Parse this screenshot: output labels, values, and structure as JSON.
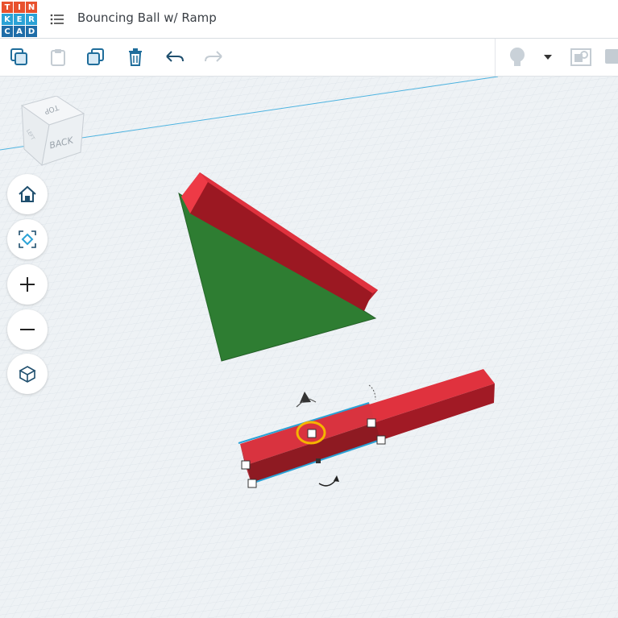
{
  "app": {
    "logo_letters": [
      "T",
      "I",
      "N",
      "K",
      "E",
      "R",
      "C",
      "A",
      "D"
    ],
    "logo_colors": [
      "#e8512d",
      "#e8512d",
      "#e8512d",
      "#2aa2d6",
      "#2aa2d6",
      "#2aa2d6",
      "#1e6da8",
      "#1e6da8",
      "#1e6da8"
    ],
    "title": "Bouncing Ball w/ Ramp"
  },
  "toolbar": {
    "icons": [
      "copy-icon",
      "paste-icon",
      "duplicate-icon",
      "delete-icon",
      "undo-icon",
      "redo-icon",
      "light-bulb-icon",
      "dropdown-icon",
      "view-toggle-icon",
      "note-icon"
    ]
  },
  "view_cube": {
    "top_label": "TOP",
    "back_label": "BACK",
    "side_label": "LEFT"
  },
  "view_controls": {
    "icons": [
      "home-icon",
      "fit-view-icon",
      "zoom-in-icon",
      "zoom-out-icon",
      "perspective-icon"
    ]
  },
  "colors": {
    "accent": "#2aa2d6",
    "shape_red": "#d32f3a",
    "shape_green": "#2e7d32",
    "highlight": "#f5b400"
  }
}
